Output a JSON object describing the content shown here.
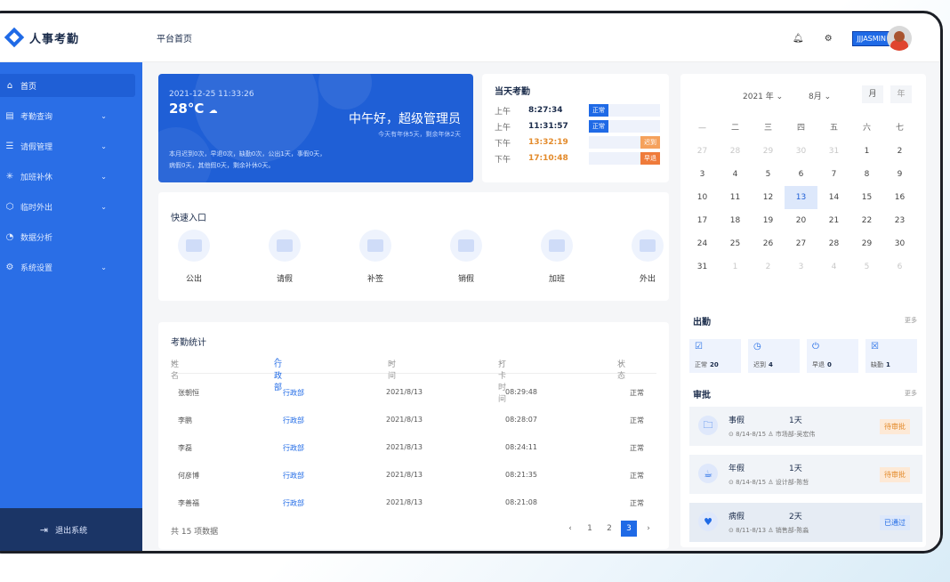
{
  "app": {
    "name": "人事考勤",
    "page_title": "平台首页"
  },
  "header": {
    "username": "JJJASMIN"
  },
  "sidebar": {
    "items": [
      {
        "label": "首页",
        "icon": "home-icon",
        "active": true,
        "expandable": false
      },
      {
        "label": "考勤查询",
        "icon": "grid-icon",
        "expandable": true
      },
      {
        "label": "请假管理",
        "icon": "form-icon",
        "expandable": true
      },
      {
        "label": "加班补休",
        "icon": "sparkle-icon",
        "expandable": true
      },
      {
        "label": "临时外出",
        "icon": "shield-icon",
        "expandable": true
      },
      {
        "label": "数据分析",
        "icon": "gauge-icon",
        "expandable": false
      },
      {
        "label": "系统设置",
        "icon": "gear-icon",
        "expandable": true
      }
    ],
    "logout_label": "退出系统"
  },
  "welcome": {
    "datetime": "2021-12-25 11:33:26",
    "temperature": "28°C",
    "greeting": "中午好，超级管理员",
    "subtext": "今天有年休5天，剩余年休2天",
    "stats_line1": "本月迟到0次，早退0次，缺勤0次，公出1天，事假0天，",
    "stats_line2": "病假0天，其他假0天，剩余补休0天。"
  },
  "attendance_today": {
    "title": "当天考勤",
    "records": [
      {
        "period": "上午",
        "time": "8:27:34",
        "status": "正常",
        "status_color": "#1f6ae6",
        "time_color": "#1a2b4a"
      },
      {
        "period": "上午",
        "time": "11:31:57",
        "status": "正常",
        "status_color": "#1f6ae6",
        "time_color": "#1a2b4a"
      },
      {
        "period": "下午",
        "time": "13:32:19",
        "status": "迟到",
        "status_color": "#f5a15c",
        "time_color": "#e38a2a"
      },
      {
        "period": "下午",
        "time": "17:10:48",
        "status": "早退",
        "status_color": "#ef7b3b",
        "time_color": "#e38a2a"
      }
    ]
  },
  "quick_entry": {
    "title": "快速入口",
    "items": [
      "公出",
      "请假",
      "补签",
      "销假",
      "加班",
      "外出"
    ]
  },
  "stats": {
    "title": "考勤统计",
    "headers": {
      "name": "姓名",
      "dept": "行政部",
      "time": "时间",
      "punch": "打卡时间",
      "status": "状态"
    },
    "rows": [
      {
        "name": "张朝恒",
        "dept": "行政部",
        "date": "2021/8/13",
        "punch": "08:29:48",
        "status": "正常"
      },
      {
        "name": "李鹏",
        "dept": "行政部",
        "date": "2021/8/13",
        "punch": "08:28:07",
        "status": "正常"
      },
      {
        "name": "李磊",
        "dept": "行政部",
        "date": "2021/8/13",
        "punch": "08:24:11",
        "status": "正常"
      },
      {
        "name": "何彦博",
        "dept": "行政部",
        "date": "2021/8/13",
        "punch": "08:21:35",
        "status": "正常"
      },
      {
        "name": "李善福",
        "dept": "行政部",
        "date": "2021/8/13",
        "punch": "08:21:08",
        "status": "正常"
      }
    ],
    "total_label": "共 15 项数据",
    "pages": [
      "1",
      "2",
      "3"
    ],
    "current_page": "3"
  },
  "calendar": {
    "year_label": "2021 年",
    "month_label": "8月",
    "view_month": "月",
    "view_year": "年",
    "weekdays": [
      "一",
      "二",
      "三",
      "四",
      "五",
      "六",
      "七"
    ],
    "weeks": [
      [
        {
          "d": "27",
          "dim": true
        },
        {
          "d": "28",
          "dim": true
        },
        {
          "d": "29",
          "dim": true
        },
        {
          "d": "30",
          "dim": true
        },
        {
          "d": "31",
          "dim": true
        },
        {
          "d": "1"
        },
        {
          "d": "2"
        }
      ],
      [
        {
          "d": "3"
        },
        {
          "d": "4"
        },
        {
          "d": "5"
        },
        {
          "d": "6"
        },
        {
          "d": "7"
        },
        {
          "d": "8"
        },
        {
          "d": "9"
        }
      ],
      [
        {
          "d": "10"
        },
        {
          "d": "11"
        },
        {
          "d": "12"
        },
        {
          "d": "13",
          "today": true
        },
        {
          "d": "14"
        },
        {
          "d": "15"
        },
        {
          "d": "16"
        }
      ],
      [
        {
          "d": "17"
        },
        {
          "d": "18"
        },
        {
          "d": "19"
        },
        {
          "d": "20"
        },
        {
          "d": "21"
        },
        {
          "d": "22"
        },
        {
          "d": "23"
        }
      ],
      [
        {
          "d": "24"
        },
        {
          "d": "25"
        },
        {
          "d": "26"
        },
        {
          "d": "27"
        },
        {
          "d": "28"
        },
        {
          "d": "29"
        },
        {
          "d": "30"
        }
      ],
      [
        {
          "d": "31"
        },
        {
          "d": "1",
          "dim": true
        },
        {
          "d": "2",
          "dim": true
        },
        {
          "d": "3",
          "dim": true
        },
        {
          "d": "4",
          "dim": true
        },
        {
          "d": "5",
          "dim": true
        },
        {
          "d": "6",
          "dim": true
        }
      ]
    ]
  },
  "attendance_summary": {
    "title": "出勤",
    "more": "更多",
    "items": [
      {
        "label": "正常",
        "count": "20",
        "icon": "check-icon"
      },
      {
        "label": "迟到",
        "count": "4",
        "icon": "clock-icon"
      },
      {
        "label": "早退",
        "count": "0",
        "icon": "power-icon"
      },
      {
        "label": "缺勤",
        "count": "1",
        "icon": "x-box-icon"
      }
    ]
  },
  "approval": {
    "title": "审批",
    "more": "更多",
    "items": [
      {
        "type": "事假",
        "days": "1天",
        "date": "8/14-8/15",
        "person": "市场部-吴宏伟",
        "status": "待审批",
        "status_color": "#e38a2a",
        "status_bg": "#fde9d6"
      },
      {
        "type": "年假",
        "days": "1天",
        "date": "8/14-8/15",
        "person": "设计部-陈哲",
        "status": "待审批",
        "status_color": "#e38a2a",
        "status_bg": "#fde9d6"
      },
      {
        "type": "病假",
        "days": "2天",
        "date": "8/11-8/13",
        "person": "销售部-陈淼",
        "status": "已通过",
        "status_color": "#1f6ae6",
        "status_bg": "#dde8fb"
      }
    ]
  }
}
